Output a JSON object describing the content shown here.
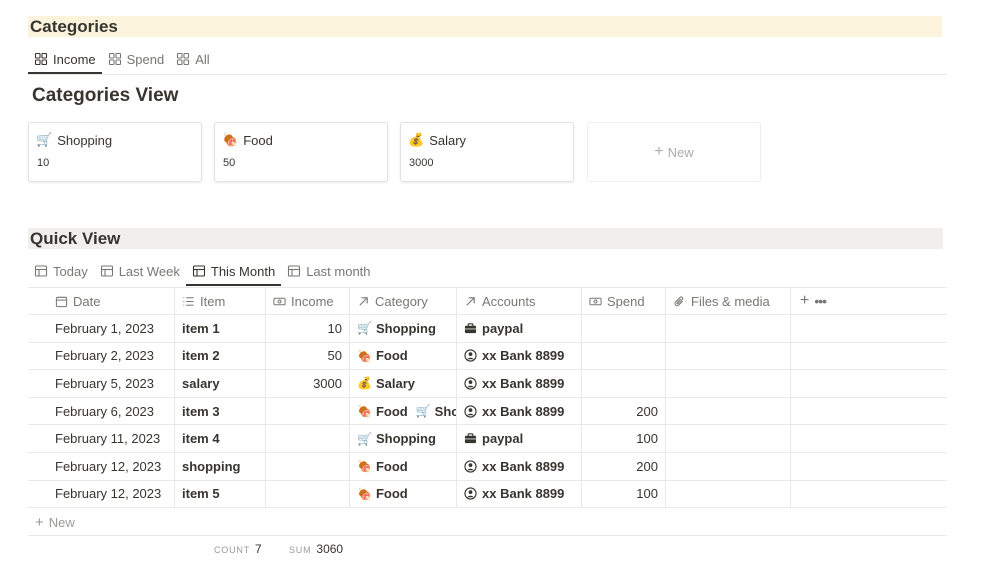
{
  "categories_section": {
    "title": "Categories",
    "tabs": [
      {
        "label": "Income",
        "active": true
      },
      {
        "label": "Spend",
        "active": false
      },
      {
        "label": "All",
        "active": false
      }
    ],
    "view_title": "Categories View",
    "cards": [
      {
        "emoji": "🛒",
        "name": "Shopping",
        "value": "10"
      },
      {
        "emoji": "🍖",
        "name": "Food",
        "value": "50"
      },
      {
        "emoji": "💰",
        "name": "Salary",
        "value": "3000"
      }
    ],
    "new_label": "New"
  },
  "quick_section": {
    "title": "Quick View",
    "tabs": [
      {
        "label": "Today",
        "active": false
      },
      {
        "label": "Last Week",
        "active": false
      },
      {
        "label": "This Month",
        "active": true
      },
      {
        "label": "Last month",
        "active": false
      }
    ],
    "columns": {
      "date": "Date",
      "item": "Item",
      "income": "Income",
      "category": "Category",
      "accounts": "Accounts",
      "spend": "Spend",
      "files": "Files & media"
    },
    "rows": [
      {
        "date": "February 1, 2023",
        "item": "item 1",
        "income": "10",
        "categories": [
          {
            "emoji": "🛒",
            "name": "Shopping"
          }
        ],
        "account_icon": "briefcase-icon",
        "account": "paypal",
        "spend": ""
      },
      {
        "date": "February 2, 2023",
        "item": "item 2",
        "income": "50",
        "categories": [
          {
            "emoji": "🍖",
            "name": "Food"
          }
        ],
        "account_icon": "person-circle-icon",
        "account": "xx Bank 8899",
        "spend": ""
      },
      {
        "date": "February 5, 2023",
        "item": "salary",
        "income": "3000",
        "categories": [
          {
            "emoji": "💰",
            "name": "Salary"
          }
        ],
        "account_icon": "person-circle-icon",
        "account": "xx Bank 8899",
        "spend": ""
      },
      {
        "date": "February 6, 2023",
        "item": "item 3",
        "income": "",
        "categories": [
          {
            "emoji": "🍖",
            "name": "Food"
          },
          {
            "emoji": "🛒",
            "name": "Sho"
          }
        ],
        "account_icon": "person-circle-icon",
        "account": "xx Bank 8899",
        "spend": "200"
      },
      {
        "date": "February 11, 2023",
        "item": "item 4",
        "income": "",
        "categories": [
          {
            "emoji": "🛒",
            "name": "Shopping"
          }
        ],
        "account_icon": "briefcase-icon",
        "account": "paypal",
        "spend": "100"
      },
      {
        "date": "February 12, 2023",
        "item": "shopping",
        "income": "",
        "categories": [
          {
            "emoji": "🍖",
            "name": "Food"
          }
        ],
        "account_icon": "person-circle-icon",
        "account": "xx Bank 8899",
        "spend": "200"
      },
      {
        "date": "February 12, 2023",
        "item": "item 5",
        "income": "",
        "categories": [
          {
            "emoji": "🍖",
            "name": "Food"
          }
        ],
        "account_icon": "person-circle-icon",
        "account": "xx Bank 8899",
        "spend": "100"
      }
    ],
    "new_label": "New",
    "footer": {
      "count_label": "COUNT",
      "count_value": "7",
      "sum_label": "SUM",
      "sum_value": "3060"
    }
  },
  "colors": {
    "categories_header_bg": "#fbf3db",
    "quick_header_bg": "#f1eeeb",
    "text": "#37352f",
    "muted": "#787774"
  }
}
